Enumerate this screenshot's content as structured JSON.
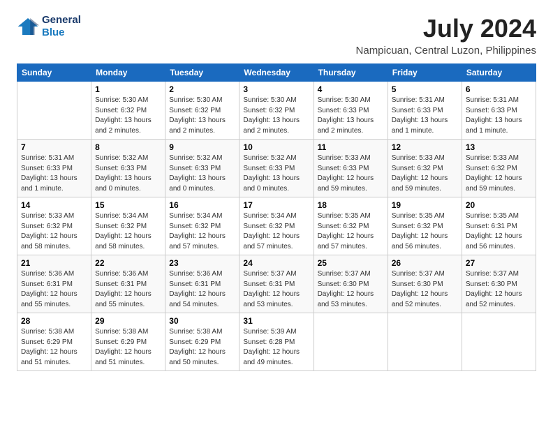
{
  "header": {
    "logo_line1": "General",
    "logo_line2": "Blue",
    "title": "July 2024",
    "subtitle": "Nampicuan, Central Luzon, Philippines"
  },
  "calendar": {
    "headers": [
      "Sunday",
      "Monday",
      "Tuesday",
      "Wednesday",
      "Thursday",
      "Friday",
      "Saturday"
    ],
    "weeks": [
      [
        {
          "day": "",
          "info": ""
        },
        {
          "day": "1",
          "info": "Sunrise: 5:30 AM\nSunset: 6:32 PM\nDaylight: 13 hours\nand 2 minutes."
        },
        {
          "day": "2",
          "info": "Sunrise: 5:30 AM\nSunset: 6:32 PM\nDaylight: 13 hours\nand 2 minutes."
        },
        {
          "day": "3",
          "info": "Sunrise: 5:30 AM\nSunset: 6:32 PM\nDaylight: 13 hours\nand 2 minutes."
        },
        {
          "day": "4",
          "info": "Sunrise: 5:30 AM\nSunset: 6:33 PM\nDaylight: 13 hours\nand 2 minutes."
        },
        {
          "day": "5",
          "info": "Sunrise: 5:31 AM\nSunset: 6:33 PM\nDaylight: 13 hours\nand 1 minute."
        },
        {
          "day": "6",
          "info": "Sunrise: 5:31 AM\nSunset: 6:33 PM\nDaylight: 13 hours\nand 1 minute."
        }
      ],
      [
        {
          "day": "7",
          "info": "Sunrise: 5:31 AM\nSunset: 6:33 PM\nDaylight: 13 hours\nand 1 minute."
        },
        {
          "day": "8",
          "info": "Sunrise: 5:32 AM\nSunset: 6:33 PM\nDaylight: 13 hours\nand 0 minutes."
        },
        {
          "day": "9",
          "info": "Sunrise: 5:32 AM\nSunset: 6:33 PM\nDaylight: 13 hours\nand 0 minutes."
        },
        {
          "day": "10",
          "info": "Sunrise: 5:32 AM\nSunset: 6:33 PM\nDaylight: 13 hours\nand 0 minutes."
        },
        {
          "day": "11",
          "info": "Sunrise: 5:33 AM\nSunset: 6:33 PM\nDaylight: 12 hours\nand 59 minutes."
        },
        {
          "day": "12",
          "info": "Sunrise: 5:33 AM\nSunset: 6:32 PM\nDaylight: 12 hours\nand 59 minutes."
        },
        {
          "day": "13",
          "info": "Sunrise: 5:33 AM\nSunset: 6:32 PM\nDaylight: 12 hours\nand 59 minutes."
        }
      ],
      [
        {
          "day": "14",
          "info": "Sunrise: 5:33 AM\nSunset: 6:32 PM\nDaylight: 12 hours\nand 58 minutes."
        },
        {
          "day": "15",
          "info": "Sunrise: 5:34 AM\nSunset: 6:32 PM\nDaylight: 12 hours\nand 58 minutes."
        },
        {
          "day": "16",
          "info": "Sunrise: 5:34 AM\nSunset: 6:32 PM\nDaylight: 12 hours\nand 57 minutes."
        },
        {
          "day": "17",
          "info": "Sunrise: 5:34 AM\nSunset: 6:32 PM\nDaylight: 12 hours\nand 57 minutes."
        },
        {
          "day": "18",
          "info": "Sunrise: 5:35 AM\nSunset: 6:32 PM\nDaylight: 12 hours\nand 57 minutes."
        },
        {
          "day": "19",
          "info": "Sunrise: 5:35 AM\nSunset: 6:32 PM\nDaylight: 12 hours\nand 56 minutes."
        },
        {
          "day": "20",
          "info": "Sunrise: 5:35 AM\nSunset: 6:31 PM\nDaylight: 12 hours\nand 56 minutes."
        }
      ],
      [
        {
          "day": "21",
          "info": "Sunrise: 5:36 AM\nSunset: 6:31 PM\nDaylight: 12 hours\nand 55 minutes."
        },
        {
          "day": "22",
          "info": "Sunrise: 5:36 AM\nSunset: 6:31 PM\nDaylight: 12 hours\nand 55 minutes."
        },
        {
          "day": "23",
          "info": "Sunrise: 5:36 AM\nSunset: 6:31 PM\nDaylight: 12 hours\nand 54 minutes."
        },
        {
          "day": "24",
          "info": "Sunrise: 5:37 AM\nSunset: 6:31 PM\nDaylight: 12 hours\nand 53 minutes."
        },
        {
          "day": "25",
          "info": "Sunrise: 5:37 AM\nSunset: 6:30 PM\nDaylight: 12 hours\nand 53 minutes."
        },
        {
          "day": "26",
          "info": "Sunrise: 5:37 AM\nSunset: 6:30 PM\nDaylight: 12 hours\nand 52 minutes."
        },
        {
          "day": "27",
          "info": "Sunrise: 5:37 AM\nSunset: 6:30 PM\nDaylight: 12 hours\nand 52 minutes."
        }
      ],
      [
        {
          "day": "28",
          "info": "Sunrise: 5:38 AM\nSunset: 6:29 PM\nDaylight: 12 hours\nand 51 minutes."
        },
        {
          "day": "29",
          "info": "Sunrise: 5:38 AM\nSunset: 6:29 PM\nDaylight: 12 hours\nand 51 minutes."
        },
        {
          "day": "30",
          "info": "Sunrise: 5:38 AM\nSunset: 6:29 PM\nDaylight: 12 hours\nand 50 minutes."
        },
        {
          "day": "31",
          "info": "Sunrise: 5:39 AM\nSunset: 6:28 PM\nDaylight: 12 hours\nand 49 minutes."
        },
        {
          "day": "",
          "info": ""
        },
        {
          "day": "",
          "info": ""
        },
        {
          "day": "",
          "info": ""
        }
      ]
    ]
  }
}
